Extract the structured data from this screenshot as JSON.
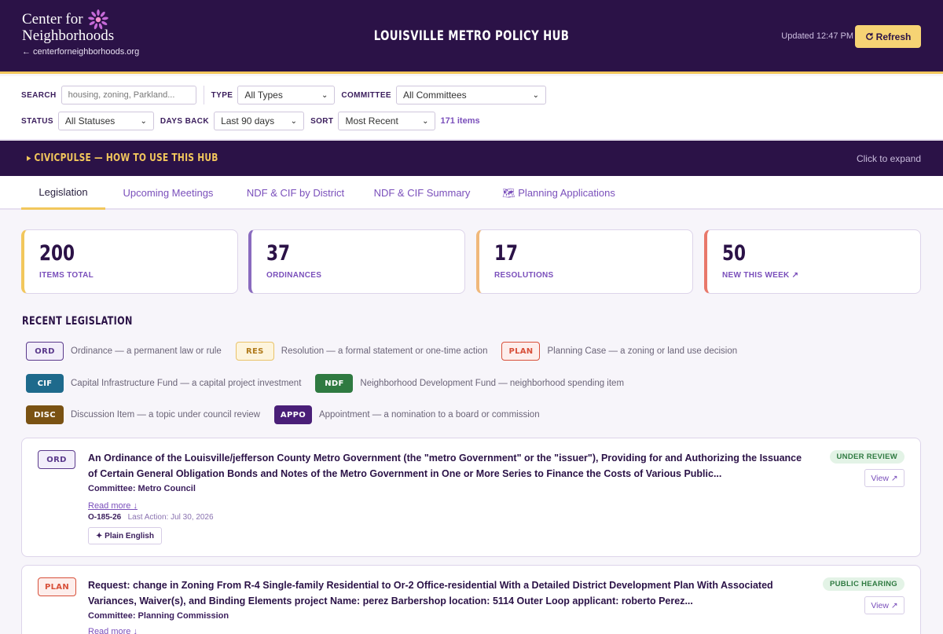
{
  "header": {
    "brand_line1": "Center for",
    "brand_line2": "Neighborhoods",
    "brand_link": "← centerforneighborhoods.org",
    "title": "LOUISVILLE METRO POLICY HUB",
    "updated": "Updated 12:47 PM",
    "refresh_label": "Refresh",
    "refresh_icon": "refresh-icon",
    "brand_color": "#2b1247",
    "accent_color": "#f2c75c"
  },
  "filters": {
    "search_label": "SEARCH",
    "search_placeholder": "housing, zoning, Parkland...",
    "type_label": "TYPE",
    "type_value": "All Types",
    "committee_label": "COMMITTEE",
    "committee_value": "All Committees",
    "status_label": "STATUS",
    "status_value": "All Statuses",
    "days_label": "DAYS BACK",
    "days_value": "Last 90 days",
    "sort_label": "SORT",
    "sort_value": "Most Recent",
    "count": "171 items"
  },
  "guide": {
    "title": "▸ CIVICPULSE — HOW TO USE THIS HUB",
    "hint": "Click to expand"
  },
  "tabs": [
    {
      "label": "Legislation",
      "active": true
    },
    {
      "label": "Upcoming Meetings"
    },
    {
      "label": "NDF & CIF by District"
    },
    {
      "label": "NDF & CIF Summary"
    },
    {
      "label": "🗺 Planning Applications"
    }
  ],
  "stats": [
    {
      "value": "200",
      "label": "ITEMS TOTAL",
      "color": "#f2c75c"
    },
    {
      "value": "37",
      "label": "ORDINANCES",
      "color": "#8a6bbf"
    },
    {
      "value": "17",
      "label": "RESOLUTIONS",
      "color": "#f0b87a"
    },
    {
      "value": "50",
      "label": "NEW THIS WEEK ↗",
      "color": "#e8786a"
    }
  ],
  "legend": {
    "title": "RECENT LEGISLATION",
    "items": [
      {
        "code": "ORD",
        "desc": "Ordinance — a permanent law or rule",
        "color": "#5b3a8c"
      },
      {
        "code": "RES",
        "desc": "Resolution — a formal statement or one-time action",
        "color": "#b07a1a"
      },
      {
        "code": "PLAN",
        "desc": "Planning Case — a zoning or land use decision",
        "color": "#d8503a"
      },
      {
        "code": "CIF",
        "desc": "Capital Infrastructure Fund — a capital project investment",
        "color": "#1e6a8c"
      },
      {
        "code": "NDF",
        "desc": "Neighborhood Development Fund — neighborhood spending item",
        "color": "#2f7a41"
      },
      {
        "code": "DISC",
        "desc": "Discussion Item — a topic under council review",
        "color": "#7a5213"
      },
      {
        "code": "APPO",
        "desc": "Appointment — a nomination to a board or commission",
        "color": "#4a1f78"
      }
    ]
  },
  "items": [
    {
      "type": "ORD",
      "title": "An Ordinance of the Louisville/jefferson County Metro Government (the \"metro Government\" or the \"issuer\"), Providing for and Authorizing the Issuance of Certain General Obligation Bonds and Notes of the Metro Government in One or More Series to Finance the Costs of Various Public...",
      "committee": "Committee: Metro Council",
      "read_more": "Read more ↓",
      "id": "O-185-26",
      "last_action": "Last Action: Jul 30, 2026",
      "plain_english": "✦ Plain English",
      "status": "UNDER REVIEW",
      "view": "View ↗"
    },
    {
      "type": "PLAN",
      "title": "Request: change in Zoning From R-4 Single-family Residential to Or-2 Office-residential With a Detailed District Development Plan With Associated Variances, Waiver(s), and Binding Elements project Name: perez Barbershop location: 5114 Outer Loop applicant: roberto Perez...",
      "committee": "Committee: Planning Commission",
      "read_more": "Read more ↓",
      "status": "PUBLIC HEARING",
      "view": "View ↗"
    }
  ]
}
